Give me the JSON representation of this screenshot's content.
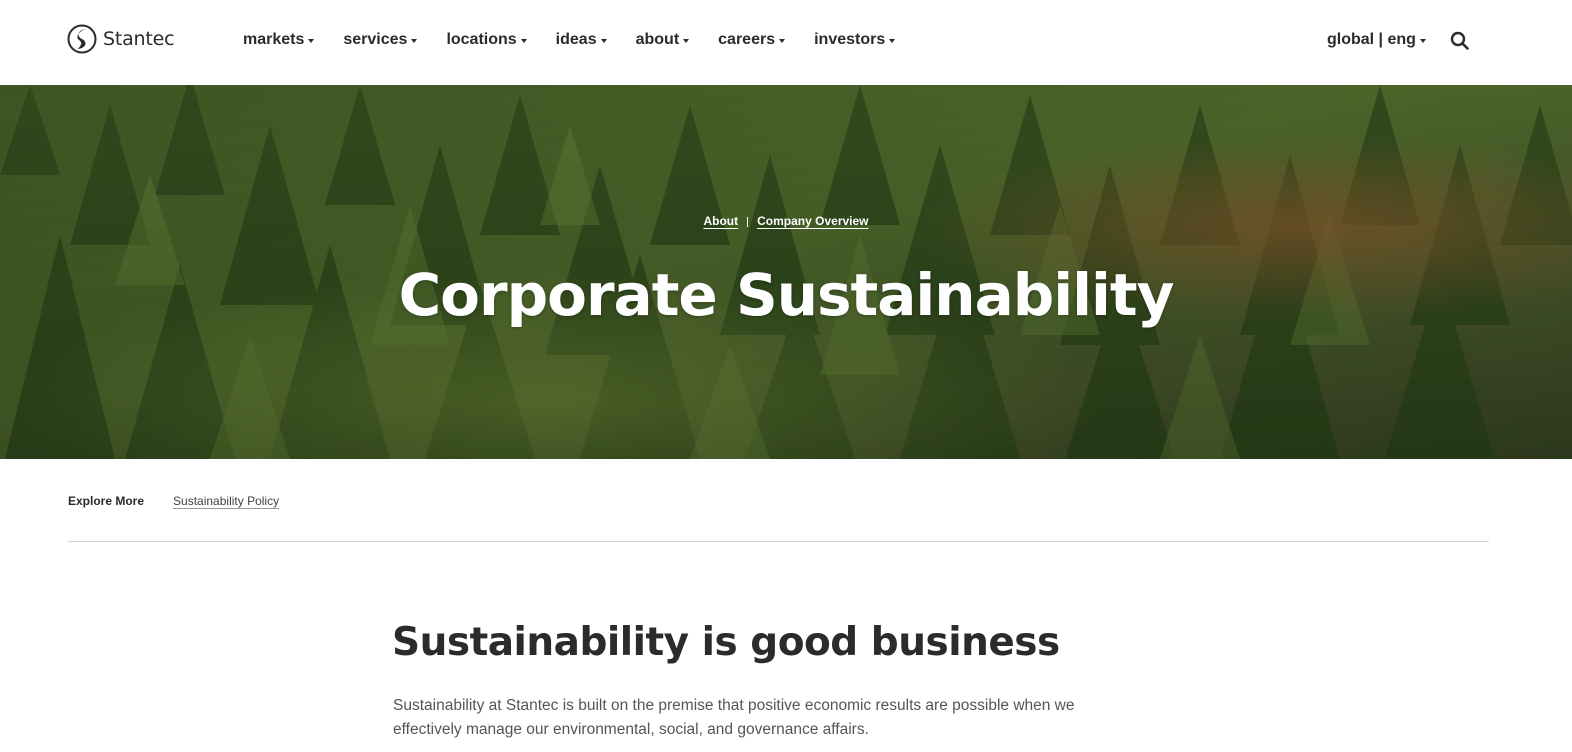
{
  "brand": {
    "name": "Stantec"
  },
  "nav": {
    "items": [
      {
        "label": "markets"
      },
      {
        "label": "services"
      },
      {
        "label": "locations"
      },
      {
        "label": "ideas"
      },
      {
        "label": "about"
      },
      {
        "label": "careers"
      },
      {
        "label": "investors"
      }
    ],
    "language": "global | eng"
  },
  "hero": {
    "breadcrumb": [
      "About",
      "Company Overview"
    ],
    "title": "Corporate Sustainability"
  },
  "explore": {
    "label": "Explore More",
    "links": [
      "Sustainability Policy"
    ]
  },
  "content": {
    "heading": "Sustainability is good business",
    "body": "Sustainability at Stantec is built on the premise that positive economic results are possible when we effectively manage our environmental, social, and governance affairs."
  },
  "colors": {
    "text": "#2b2b2b",
    "body_text": "#555555",
    "hero_overlay": "#3d4d2a"
  }
}
